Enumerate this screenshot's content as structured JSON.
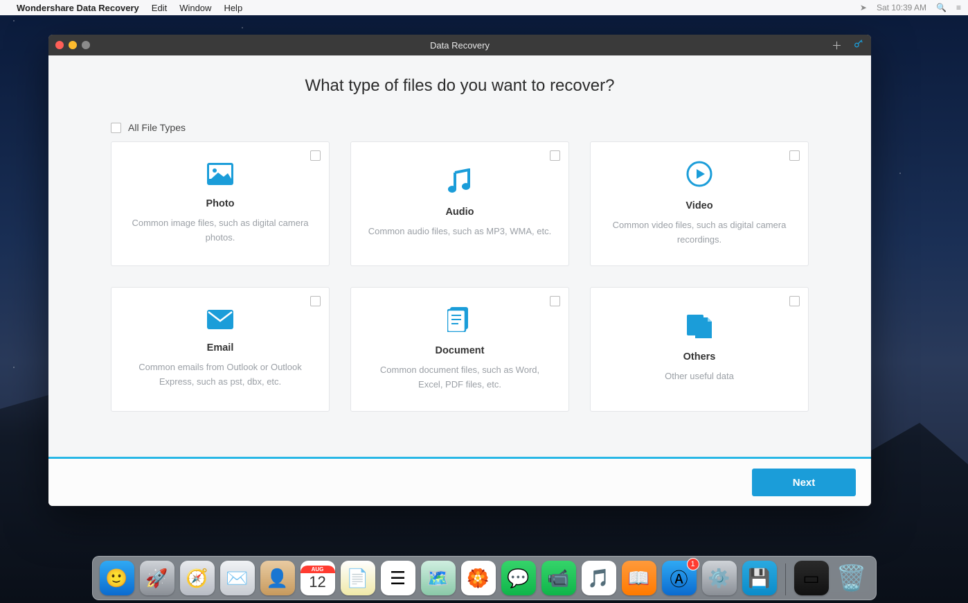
{
  "menubar": {
    "app_name": "Wondershare Data Recovery",
    "items": [
      "Edit",
      "Window",
      "Help"
    ],
    "clock": "Sat 10:39 AM"
  },
  "window": {
    "title": "Data Recovery",
    "heading": "What type of files do you want to recover?",
    "all_types_label": "All File Types",
    "next_label": "Next"
  },
  "cards": [
    {
      "id": "photo",
      "title": "Photo",
      "desc": "Common image files, such as digital camera photos."
    },
    {
      "id": "audio",
      "title": "Audio",
      "desc": "Common audio files, such as MP3, WMA, etc."
    },
    {
      "id": "video",
      "title": "Video",
      "desc": "Common video files, such as digital camera recordings."
    },
    {
      "id": "email",
      "title": "Email",
      "desc": "Common emails from Outlook or Outlook Express, such as pst, dbx, etc."
    },
    {
      "id": "document",
      "title": "Document",
      "desc": "Common document files, such as Word, Excel, PDF files, etc."
    },
    {
      "id": "others",
      "title": "Others",
      "desc": "Other useful data"
    }
  ],
  "dock": {
    "badge_count": "1",
    "items": [
      {
        "name": "finder",
        "bg": "linear-gradient(#2fa9f4,#0b6bcf)",
        "glyph": "🙂"
      },
      {
        "name": "launchpad",
        "bg": "linear-gradient(#cfd3d8,#8a8f96)",
        "glyph": "🚀"
      },
      {
        "name": "safari",
        "bg": "linear-gradient(#e8eaee,#b8bcc4)",
        "glyph": "🧭"
      },
      {
        "name": "mail",
        "bg": "linear-gradient(#f0f2f5,#c8ccd2)",
        "glyph": "✉️"
      },
      {
        "name": "contacts",
        "bg": "linear-gradient(#e9cba2,#c79a5d)",
        "glyph": "👤"
      },
      {
        "name": "calendar",
        "bg": "#ffffff",
        "glyph": "cal"
      },
      {
        "name": "notes",
        "bg": "linear-gradient(#fff,#f0e9a8)",
        "glyph": "📄"
      },
      {
        "name": "reminders",
        "bg": "#ffffff",
        "glyph": "☰"
      },
      {
        "name": "maps",
        "bg": "linear-gradient(#cfeee0,#8ac9a8)",
        "glyph": "🗺️"
      },
      {
        "name": "photos",
        "bg": "#ffffff",
        "glyph": "🏵️"
      },
      {
        "name": "messages",
        "bg": "linear-gradient(#35d46a,#0fb54a)",
        "glyph": "💬"
      },
      {
        "name": "facetime",
        "bg": "linear-gradient(#35d46a,#0fb54a)",
        "glyph": "📹"
      },
      {
        "name": "itunes",
        "bg": "#ffffff",
        "glyph": "🎵"
      },
      {
        "name": "ibooks",
        "bg": "linear-gradient(#ff9a3b,#ff7a00)",
        "glyph": "📖"
      },
      {
        "name": "app-store",
        "bg": "linear-gradient(#2fa9f4,#0b6bcf)",
        "glyph": "Ⓐ",
        "badge": true
      },
      {
        "name": "preferences",
        "bg": "linear-gradient(#cfd3d8,#8a8f96)",
        "glyph": "⚙️"
      },
      {
        "name": "wondershare-data-recovery",
        "bg": "linear-gradient(#2aa9e0,#0b8cc9)",
        "glyph": "💾"
      }
    ],
    "right_items": [
      {
        "name": "desktop-preview",
        "bg": "linear-gradient(#2a2a2a,#111)",
        "glyph": "▭"
      },
      {
        "name": "trash",
        "bg": "transparent",
        "glyph": "🗑️"
      }
    ],
    "calendar": {
      "month": "AUG",
      "day": "12"
    }
  }
}
